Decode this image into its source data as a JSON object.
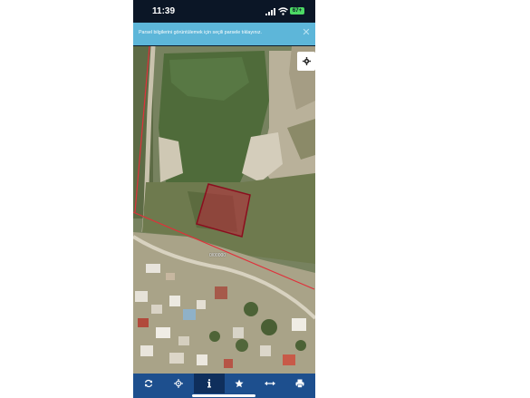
{
  "status_bar": {
    "time": "11:39",
    "battery": "67+"
  },
  "notice": {
    "text": "Parsel bilgilerini görüntülemek için seçili parsele tıklayınız.",
    "close_icon": "close-icon",
    "close_glyph": "✕"
  },
  "map": {
    "parcel_label": "0/00000",
    "settings_icon": "gear-icon",
    "colors": {
      "parcel_fill": "#b8283a",
      "parcel_border": "#8b0e1e",
      "boundary_line": "#e0303a",
      "vegetation": "#4f6b3a",
      "ground": "#b9b19a"
    }
  },
  "toolbar": {
    "items": [
      {
        "icon": "refresh-icon",
        "active": false
      },
      {
        "icon": "locate-icon",
        "active": false
      },
      {
        "icon": "info-icon",
        "active": true
      },
      {
        "icon": "star-icon",
        "active": false
      },
      {
        "icon": "measure-icon",
        "active": false
      },
      {
        "icon": "print-icon",
        "active": false
      }
    ]
  }
}
